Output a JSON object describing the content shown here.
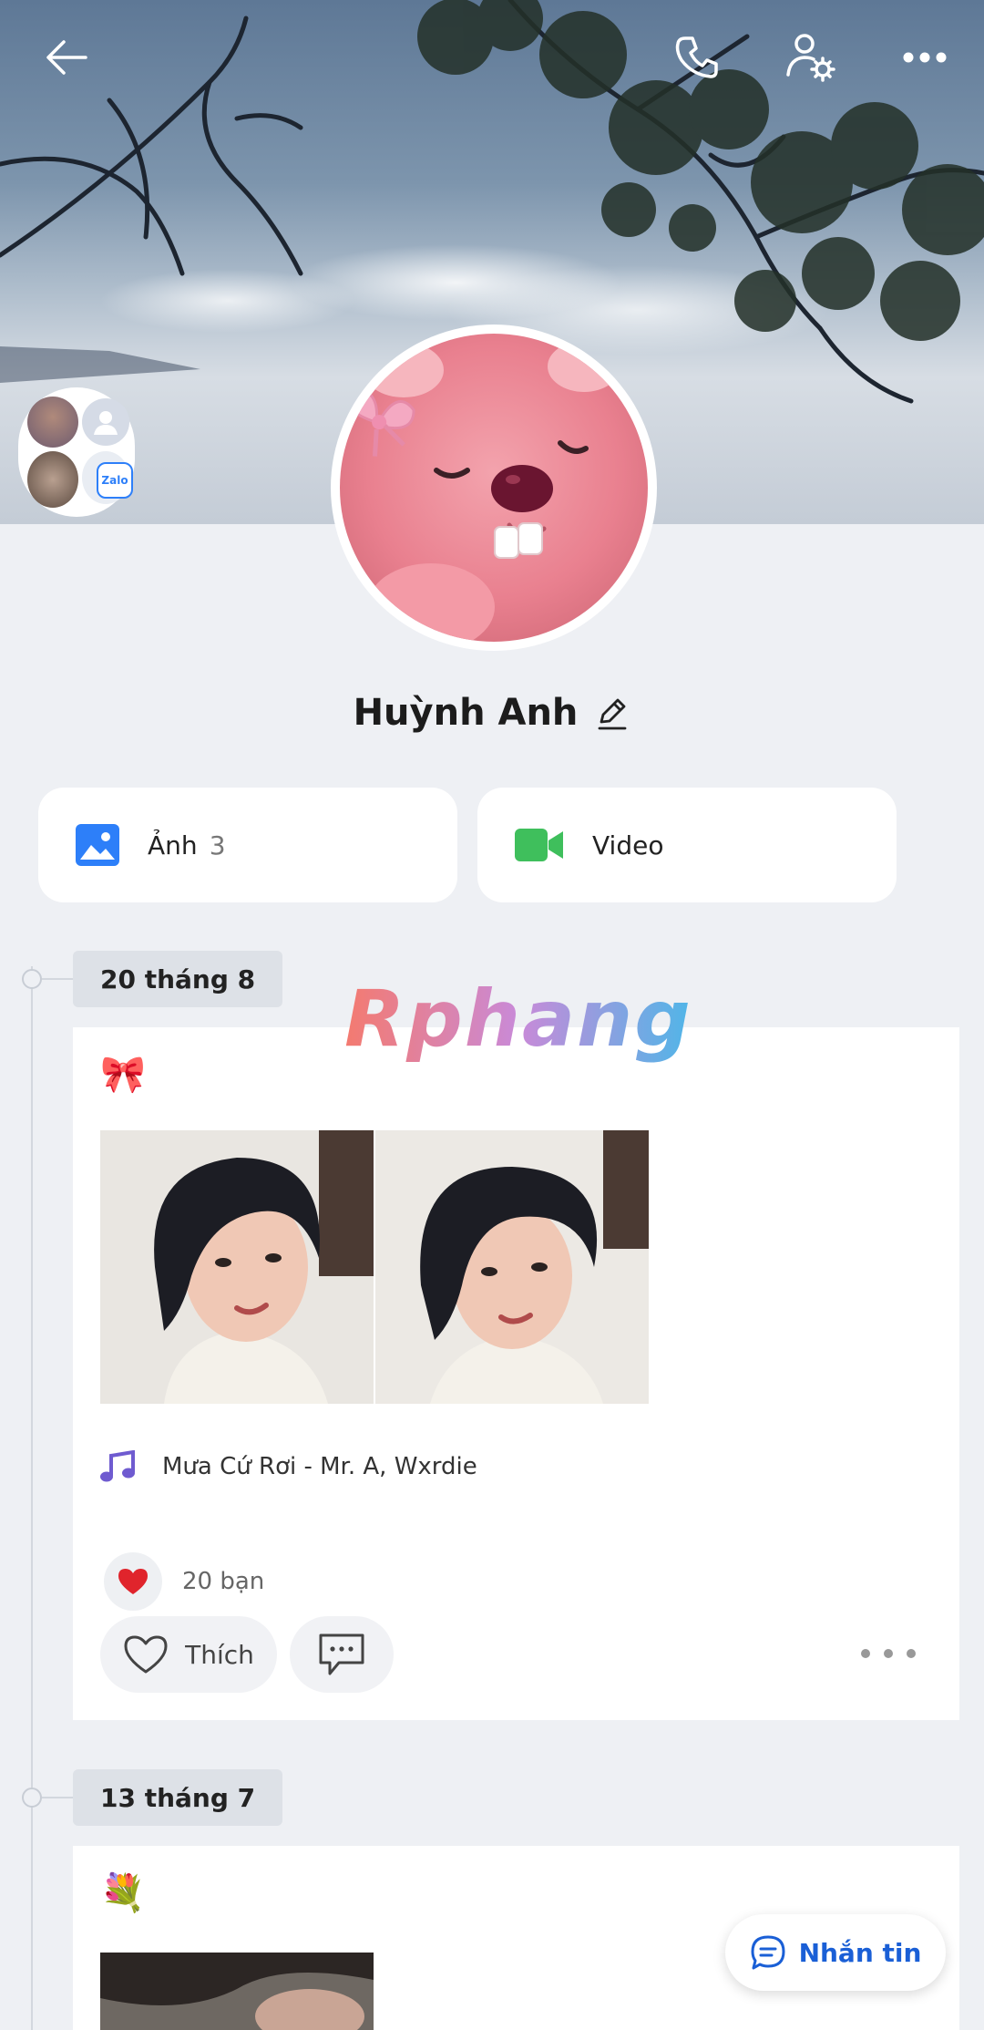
{
  "profile": {
    "name": "Huỳnh Anh",
    "zalo_badge": "Zalo"
  },
  "media": {
    "photos_label": "Ảnh",
    "photos_count": "3",
    "video_label": "Video"
  },
  "watermark": "Rphang",
  "posts": [
    {
      "date": "20 tháng 8",
      "emoji": "🎀",
      "music": "Mưa Cứ Rơi - Mr. A, Wxrdie",
      "reaction_count": "20 bạn",
      "like_label": "Thích"
    },
    {
      "date": "13 tháng 7",
      "emoji": "💐"
    }
  ],
  "floating": {
    "message_label": "Nhắn tin"
  },
  "icons": {
    "back": "arrow-left-icon",
    "call": "phone-icon",
    "settings": "user-settings-icon",
    "more": "more-horizontal-icon",
    "edit": "pencil-icon",
    "photos": "image-icon",
    "video": "video-camera-icon",
    "music": "music-note-icon",
    "heart_reaction": "red-heart-icon",
    "like": "heart-outline-icon",
    "comment": "comment-icon",
    "message": "chat-bubble-icon"
  },
  "colors": {
    "accent_blue": "#1a5fd6",
    "video_green": "#3fbf5c",
    "photo_blue": "#2d7ff9",
    "music_purple": "#6f5bd0",
    "heart_red": "#e0242c"
  }
}
